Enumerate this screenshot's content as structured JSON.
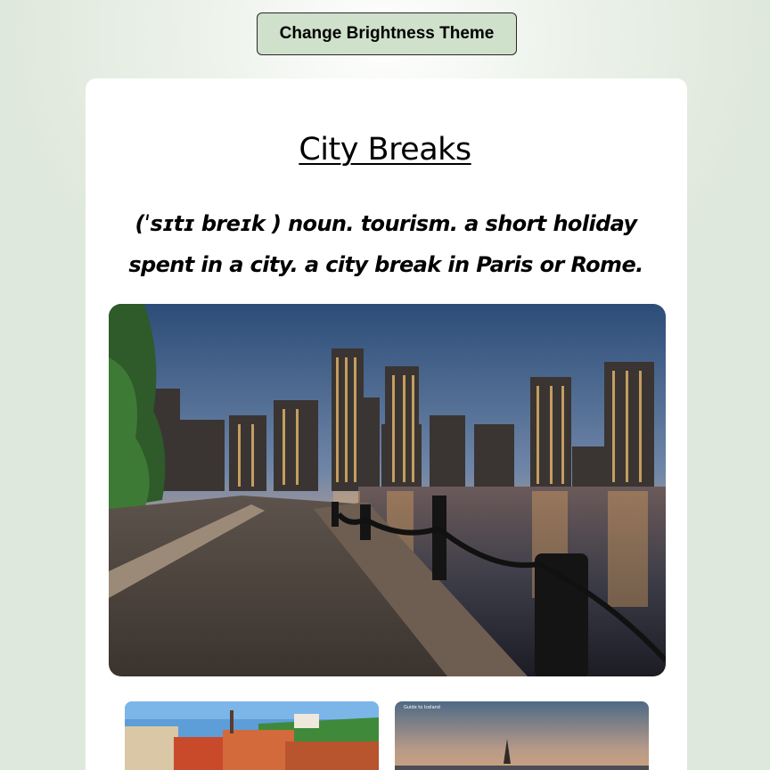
{
  "controls": {
    "theme_button_label": "Change Brightness Theme"
  },
  "article": {
    "title": "City Breaks",
    "definition": "(ˈsɪtɪ breɪk ) noun. tourism. a short holiday spent in a city. a city break in Paris or Rome."
  },
  "images": {
    "hero": "city-waterfront-at-dusk",
    "thumb_1": "old-town-rooftops-castle",
    "thumb_2": "harbour-at-sunset",
    "thumb_2_caption": "Guide to Iceland"
  }
}
